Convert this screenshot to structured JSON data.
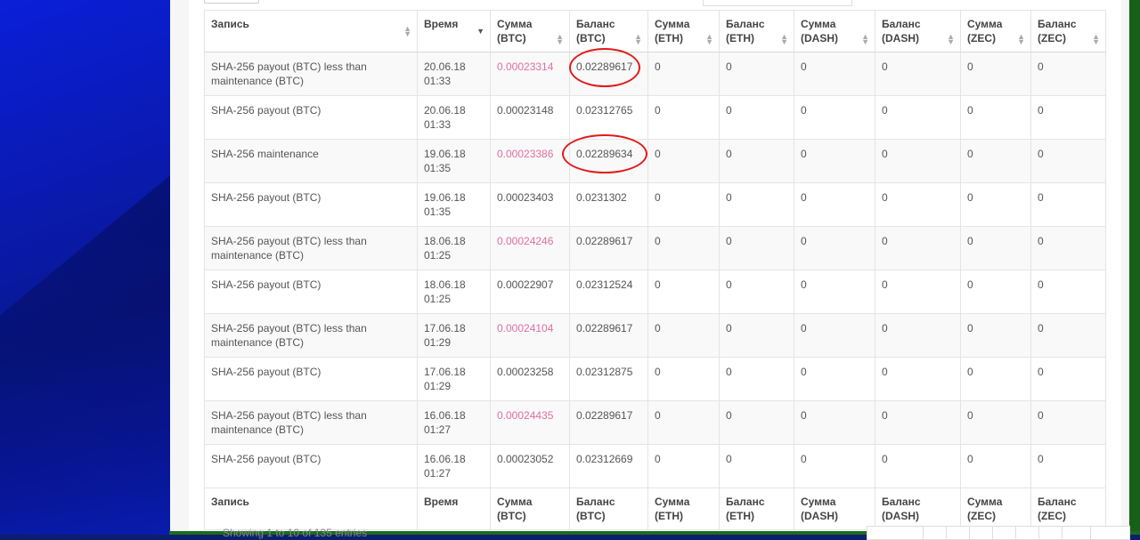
{
  "table": {
    "headers": [
      {
        "label": "Запись",
        "sort": "both"
      },
      {
        "label": "Время",
        "sort": "desc"
      },
      {
        "label": "Сумма (BTC)",
        "sort": "both"
      },
      {
        "label": "Баланс (BTC)",
        "sort": "both"
      },
      {
        "label": "Сумма (ETH)",
        "sort": "both"
      },
      {
        "label": "Баланс (ETH)",
        "sort": "both"
      },
      {
        "label": "Сумма (DASH)",
        "sort": "both"
      },
      {
        "label": "Баланс (DASH)",
        "sort": "both"
      },
      {
        "label": "Сумма (ZEC)",
        "sort": "both"
      },
      {
        "label": "Баланс (ZEC)",
        "sort": "both"
      }
    ],
    "rows": [
      {
        "record": "SHA-256 payout (BTC) less than maintenance (BTC)",
        "time": "20.06.18 01:33",
        "sum_btc": "0.00023314",
        "bal_btc": "0.02289617",
        "sum_eth": "0",
        "bal_eth": "0",
        "sum_dash": "0",
        "bal_dash": "0",
        "sum_zec": "0",
        "bal_zec": "0",
        "highlight": true
      },
      {
        "record": "SHA-256 payout (BTC)",
        "time": "20.06.18 01:33",
        "sum_btc": "0.00023148",
        "bal_btc": "0.02312765",
        "sum_eth": "0",
        "bal_eth": "0",
        "sum_dash": "0",
        "bal_dash": "0",
        "sum_zec": "0",
        "bal_zec": "0",
        "highlight": false
      },
      {
        "record": "SHA-256 maintenance",
        "time": "19.06.18 01:35",
        "sum_btc": "0.00023386",
        "bal_btc": "0.02289634",
        "sum_eth": "0",
        "bal_eth": "0",
        "sum_dash": "0",
        "bal_dash": "0",
        "sum_zec": "0",
        "bal_zec": "0",
        "highlight": true
      },
      {
        "record": "SHA-256 payout (BTC)",
        "time": "19.06.18 01:35",
        "sum_btc": "0.00023403",
        "bal_btc": "0.0231302",
        "sum_eth": "0",
        "bal_eth": "0",
        "sum_dash": "0",
        "bal_dash": "0",
        "sum_zec": "0",
        "bal_zec": "0",
        "highlight": false
      },
      {
        "record": "SHA-256 payout (BTC) less than maintenance (BTC)",
        "time": "18.06.18 01:25",
        "sum_btc": "0.00024246",
        "bal_btc": "0.02289617",
        "sum_eth": "0",
        "bal_eth": "0",
        "sum_dash": "0",
        "bal_dash": "0",
        "sum_zec": "0",
        "bal_zec": "0",
        "highlight": true
      },
      {
        "record": "SHA-256 payout (BTC)",
        "time": "18.06.18 01:25",
        "sum_btc": "0.00022907",
        "bal_btc": "0.02312524",
        "sum_eth": "0",
        "bal_eth": "0",
        "sum_dash": "0",
        "bal_dash": "0",
        "sum_zec": "0",
        "bal_zec": "0",
        "highlight": false
      },
      {
        "record": "SHA-256 payout (BTC) less than maintenance (BTC)",
        "time": "17.06.18 01:29",
        "sum_btc": "0.00024104",
        "bal_btc": "0.02289617",
        "sum_eth": "0",
        "bal_eth": "0",
        "sum_dash": "0",
        "bal_dash": "0",
        "sum_zec": "0",
        "bal_zec": "0",
        "highlight": true
      },
      {
        "record": "SHA-256 payout (BTC)",
        "time": "17.06.18 01:29",
        "sum_btc": "0.00023258",
        "bal_btc": "0.02312875",
        "sum_eth": "0",
        "bal_eth": "0",
        "sum_dash": "0",
        "bal_dash": "0",
        "sum_zec": "0",
        "bal_zec": "0",
        "highlight": false
      },
      {
        "record": "SHA-256 payout (BTC) less than maintenance (BTC)",
        "time": "16.06.18 01:27",
        "sum_btc": "0.00024435",
        "bal_btc": "0.02289617",
        "sum_eth": "0",
        "bal_eth": "0",
        "sum_dash": "0",
        "bal_dash": "0",
        "sum_zec": "0",
        "bal_zec": "0",
        "highlight": true
      },
      {
        "record": "SHA-256 payout (BTC)",
        "time": "16.06.18 01:27",
        "sum_btc": "0.00023052",
        "bal_btc": "0.02312669",
        "sum_eth": "0",
        "bal_eth": "0",
        "sum_dash": "0",
        "bal_dash": "0",
        "sum_zec": "0",
        "bal_zec": "0",
        "highlight": false
      }
    ],
    "footer": [
      "Запись",
      "Время",
      "Сумма (BTC)",
      "Баланс (BTC)",
      "Сумма (ETH)",
      "Баланс (ETH)",
      "Сумма (DASH)",
      "Баланс (DASH)",
      "Сумма (ZEC)",
      "Баланс (ZEC)"
    ]
  },
  "info_text": "Showing 1 to 10 of 135 entries",
  "colors": {
    "highlight_amount": "#e06f9f",
    "annotation": "#e21a1a"
  }
}
